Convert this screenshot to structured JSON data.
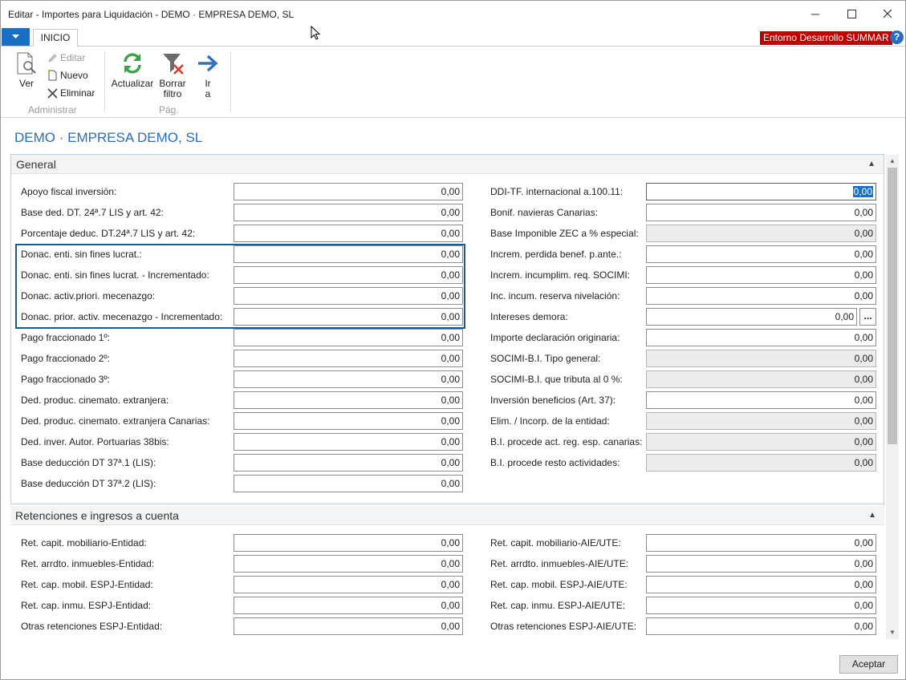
{
  "window": {
    "title": "Editar - Importes para Liquidación - DEMO · EMPRESA DEMO, SL"
  },
  "ribbon": {
    "tab": "INICIO",
    "environment": "Entorno Desarrollo SUMMAR",
    "help": "?",
    "ver": "Ver",
    "editar": "Editar",
    "nuevo": "Nuevo",
    "eliminar": "Eliminar",
    "group_administrar": "Administrar",
    "actualizar": "Actualizar",
    "borrar_filtro_1": "Borrar",
    "borrar_filtro_2": "filtro",
    "ir_1": "Ir",
    "ir_2": "a",
    "group_pag": "Pág."
  },
  "page_title": "DEMO · EMPRESA DEMO, SL",
  "general": {
    "title": "General",
    "left": [
      {
        "label": "Apoyo fiscal inversión:",
        "value": "0,00"
      },
      {
        "label": "Base ded. DT. 24ª.7 LIS y art. 42:",
        "value": "0,00"
      },
      {
        "label": "Porcentaje deduc. DT.24ª.7 LIS y art. 42:",
        "value": "0,00"
      },
      {
        "label": "Donac. enti. sin fines lucrat.:",
        "value": "0,00"
      },
      {
        "label": "Donac. enti. sin fines lucrat. - Incrementado:",
        "value": "0,00"
      },
      {
        "label": "Donac. activ.priori. mecenazgo:",
        "value": "0,00"
      },
      {
        "label": "Donac. prior. activ. mecenazgo - Incrementado:",
        "value": "0,00"
      },
      {
        "label": "Pago fraccionado 1º:",
        "value": "0,00"
      },
      {
        "label": "Pago fraccionado 2º:",
        "value": "0,00"
      },
      {
        "label": "Pago fraccionado 3º:",
        "value": "0,00"
      },
      {
        "label": "Ded. produc. cinemato. extranjera:",
        "value": "0,00"
      },
      {
        "label": "Ded. produc. cinemato. extranjera Canarias:",
        "value": "0,00"
      },
      {
        "label": "Ded. inver. Autor. Portuarias 38bis:",
        "value": "0,00"
      },
      {
        "label": "Base deducción DT 37ª.1 (LIS):",
        "value": "0,00"
      },
      {
        "label": "Base deducción DT 37ª.2 (LIS):",
        "value": "0,00"
      }
    ],
    "right": [
      {
        "label": "DDI-TF. internacional a.100.11:",
        "value": "0,00"
      },
      {
        "label": "Bonif. navieras Canarias:",
        "value": "0,00"
      },
      {
        "label": "Base Imponible ZEC a % especial:",
        "value": "0,00"
      },
      {
        "label": "Increm. perdida benef. p.ante.:",
        "value": "0,00"
      },
      {
        "label": "Increm. incumplim. req. SOCIMI:",
        "value": "0,00"
      },
      {
        "label": "Inc. incum. reserva nivelación:",
        "value": "0,00"
      },
      {
        "label": "Intereses demora:",
        "value": "0,00"
      },
      {
        "label": "Importe declaración originaria:",
        "value": "0,00"
      },
      {
        "label": "SOCIMI-B.I. Tipo general:",
        "value": "0,00"
      },
      {
        "label": "SOCIMI-B.I. que tributa al 0 %:",
        "value": "0,00"
      },
      {
        "label": "Inversión beneficios (Art. 37):",
        "value": "0,00"
      },
      {
        "label": "Elim. / Incorp. de la entidad:",
        "value": "0,00"
      },
      {
        "label": "B.I. procede act. reg. esp. canarias:",
        "value": "0,00"
      },
      {
        "label": "B.I. procede resto actividades:",
        "value": "0,00"
      }
    ],
    "assist_label": "..."
  },
  "retenciones": {
    "title": "Retenciones e ingresos a cuenta",
    "left": [
      {
        "label": "Ret. capit. mobiliario-Entidad:",
        "value": "0,00"
      },
      {
        "label": "Ret. arrdto. inmuebles-Entidad:",
        "value": "0,00"
      },
      {
        "label": "Ret. cap. mobil. ESPJ-Entidad:",
        "value": "0,00"
      },
      {
        "label": "Ret. cap. inmu. ESPJ-Entidad:",
        "value": "0,00"
      },
      {
        "label": "Otras retenciones ESPJ-Entidad:",
        "value": "0,00"
      }
    ],
    "right": [
      {
        "label": "Ret. capit. mobiliario-AIE/UTE:",
        "value": "0,00"
      },
      {
        "label": "Ret. arrdto. inmuebles-AIE/UTE:",
        "value": "0,00"
      },
      {
        "label": "Ret. cap. mobil. ESPJ-AIE/UTE:",
        "value": "0,00"
      },
      {
        "label": "Ret. cap. inmu. ESPJ-AIE/UTE:",
        "value": "0,00"
      },
      {
        "label": "Otras retenciones ESPJ-AIE/UTE:",
        "value": "0,00"
      }
    ]
  },
  "accept_button": "Aceptar",
  "colors": {
    "accent": "#2a6ebb",
    "env_badge": "#c00000",
    "highlight": "#1d5a8e"
  }
}
